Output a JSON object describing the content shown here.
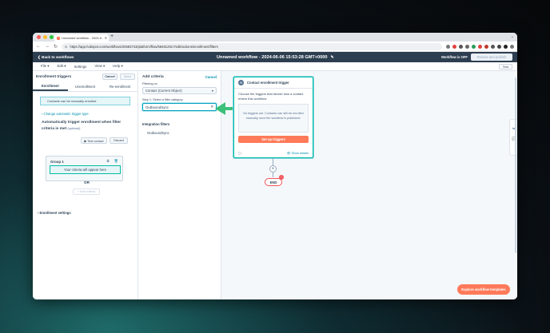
{
  "browser": {
    "tab_title": "Unnamed workflow - 2024-0...",
    "tab_close": "✕",
    "new_tab": "+",
    "tab_menu": "⌄",
    "back": "←",
    "forward": "→",
    "reload": "↻",
    "url": "https://app.hubspot.com/workflows/20683743/platform/flow/584812917/edit/actions/enrollment/filters"
  },
  "colors": {
    "brand_orange": "#ff7a59",
    "header_navy": "#2d3e50",
    "teal_accent": "#00bda5",
    "link": "#0091ae",
    "arrow_green": "#3cc07a"
  },
  "header": {
    "back_label": "❮ Back to workflows",
    "title": "Unnamed workflow - 2024-06-06 15:53:28 GMT+0000",
    "pencil": "✎",
    "status": "Workflow is OFF",
    "review_label": "Review and publish"
  },
  "menu": {
    "items": [
      "File ▾",
      "Edit ▾",
      "Settings",
      "View ▾",
      "Help ▾"
    ],
    "test_label": "Test"
  },
  "left_panel": {
    "title": "Enrollment triggers",
    "cancel": "Cancel",
    "save": "Save",
    "tabs": [
      "Enrollment",
      "Unenrollment",
      "Re-enrollment"
    ],
    "info": "Contacts can be manually enrolled",
    "change_link": "› Change automatic trigger type",
    "auto_title": "Automatically trigger enrollment when filter criteria is met",
    "optional": "(optional)",
    "test_contact": "▶ Test contact",
    "discard": "Discard",
    "group_title": "Group 1",
    "group_copy": "⧉",
    "group_delete": "🗑",
    "criteria_placeholder": "Your criteria will appear here",
    "or": "OR",
    "add_criteria": "+ Add criteria",
    "enroll_settings": "›  Enrollment settings"
  },
  "mid_panel": {
    "title": "Add criteria",
    "cancel": "Cancel",
    "filtering_label": "Filtering on",
    "object_value": "Contact (Current Object)",
    "step_label": "Step 1: Select a filter category",
    "search_value": "OutboundSync",
    "clear": "✕",
    "integration_title": "Integration filters",
    "integration_item": "OutboundSync"
  },
  "canvas": {
    "card_icon": "⚇",
    "card_title": "Contact enrollment trigger",
    "card_desc": "Choose the triggers that decide how a contact enters this workflow.",
    "card_note": "No triggers set. Contacts can still be enrolled manually once the workflow is published.",
    "setup_label": "Set up triggers",
    "card_comment": "▢",
    "details": "👁 Show details",
    "plus": "+",
    "end": "END",
    "end_badge": "!",
    "rail_icons": [
      "⇆",
      "💬"
    ],
    "explore_label": "Explore workflow templates"
  }
}
